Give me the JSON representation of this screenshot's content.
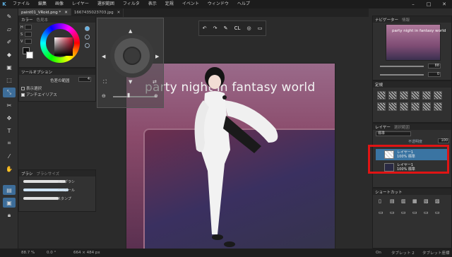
{
  "menubar": {
    "items": [
      "ファイル",
      "編集",
      "画像",
      "レイヤー",
      "選択範囲",
      "フィルタ",
      "表示",
      "定規",
      "イベント",
      "ウィンドウ",
      "ヘルプ"
    ],
    "logo": "K"
  },
  "window_controls": {
    "minimize": "–",
    "maximize": "□",
    "close": "✕"
  },
  "tabs": [
    {
      "label": "paint01_VRoid.png *",
      "close": "✕"
    },
    {
      "label": "1667435023703.jpg",
      "close": "✕"
    }
  ],
  "color_panel": {
    "tabs": [
      "カラー",
      "色見本"
    ],
    "labels": {
      "h": "H",
      "s": "S",
      "v": "V"
    }
  },
  "tool_options": {
    "title": "ツールオプション",
    "range_label": "色差の範囲",
    "range_value": "4",
    "show_selection": "表示選択",
    "antialias": "アンチエイリアス"
  },
  "brush_panel": {
    "tabs": [
      "ブラシ",
      "ブラシサイズ"
    ],
    "brushes": [
      "エアブラシ",
      "ペンデール",
      "スタンプ"
    ]
  },
  "floating_toolbar": {
    "undo": "↶",
    "redo": "↷",
    "pen": "✎",
    "cl": "CL",
    "target": "◎",
    "window": "▭"
  },
  "canvas": {
    "title_text": "party night in fantasy world"
  },
  "navigator_panel": {
    "tabs": [
      "ナビゲーター",
      "情報"
    ],
    "thumb_text": "party night in fantasy world",
    "zoom_value": "88",
    "rotate_value": "0"
  },
  "texture_panel": {
    "title": "定規"
  },
  "layer_panel": {
    "tabs": [
      "レイヤー",
      "選択範囲"
    ],
    "blend_mode": "標準",
    "opacity_label": "不透明度",
    "opacity_value": "100",
    "layers": [
      {
        "name": "レイヤー1",
        "detail": "100% 標準"
      },
      {
        "name": "レイヤー1",
        "detail": "100% 標準"
      }
    ]
  },
  "shortcut_panel": {
    "title": "ショートカット"
  },
  "status_bar": {
    "zoom": "88.7 %",
    "angle": "0.0 °",
    "size": "664 × 484 px",
    "pen": "On",
    "tablet1": "タブレット 2",
    "tablet2": "タブレット座標"
  },
  "colors": {
    "accent": "#3a74a2",
    "highlight": "#e01414"
  }
}
